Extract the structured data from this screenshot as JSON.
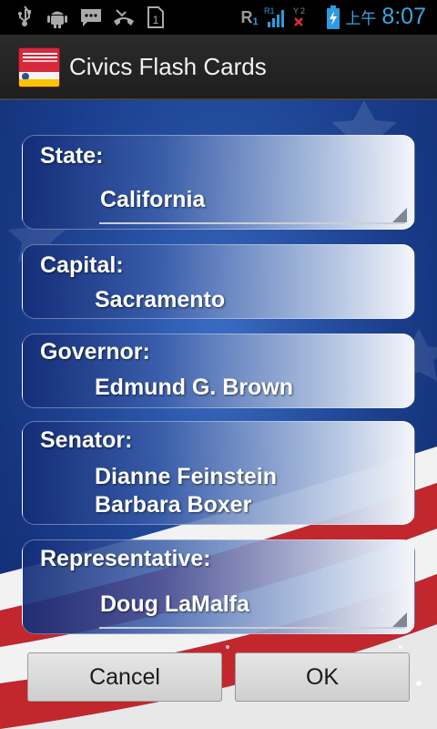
{
  "status_bar": {
    "icons": [
      "usb-icon",
      "android-debug-icon",
      "message-icon",
      "missed-call-icon",
      "sim-icon",
      "roaming-icon",
      "signal-icon",
      "signal-icon",
      "battery-charging-icon"
    ],
    "roaming": "R",
    "sim1_label": "1",
    "signal1_label": "R1",
    "signal2_label": "2",
    "sim_slot": "1",
    "ampm": "上午",
    "time": "8:07",
    "time_color": "#36a9e1"
  },
  "action_bar": {
    "title": "Civics Flash Cards",
    "logo_icon": "app-logo-icon"
  },
  "cards": {
    "state": {
      "label": "State:",
      "value": "California"
    },
    "capital": {
      "label": "Capital:",
      "value": "Sacramento"
    },
    "governor": {
      "label": "Governor:",
      "value": "Edmund G. Brown"
    },
    "senator": {
      "label": "Senator:",
      "values": [
        "Dianne Feinstein",
        "Barbara Boxer"
      ]
    },
    "representative": {
      "label": "Representative:",
      "value": "Doug LaMalfa"
    }
  },
  "buttons": {
    "cancel": "Cancel",
    "ok": "OK"
  },
  "colors": {
    "flag_blue": "#1a3f8f",
    "flag_red": "#c1272d",
    "accent": "#36a9e1"
  }
}
